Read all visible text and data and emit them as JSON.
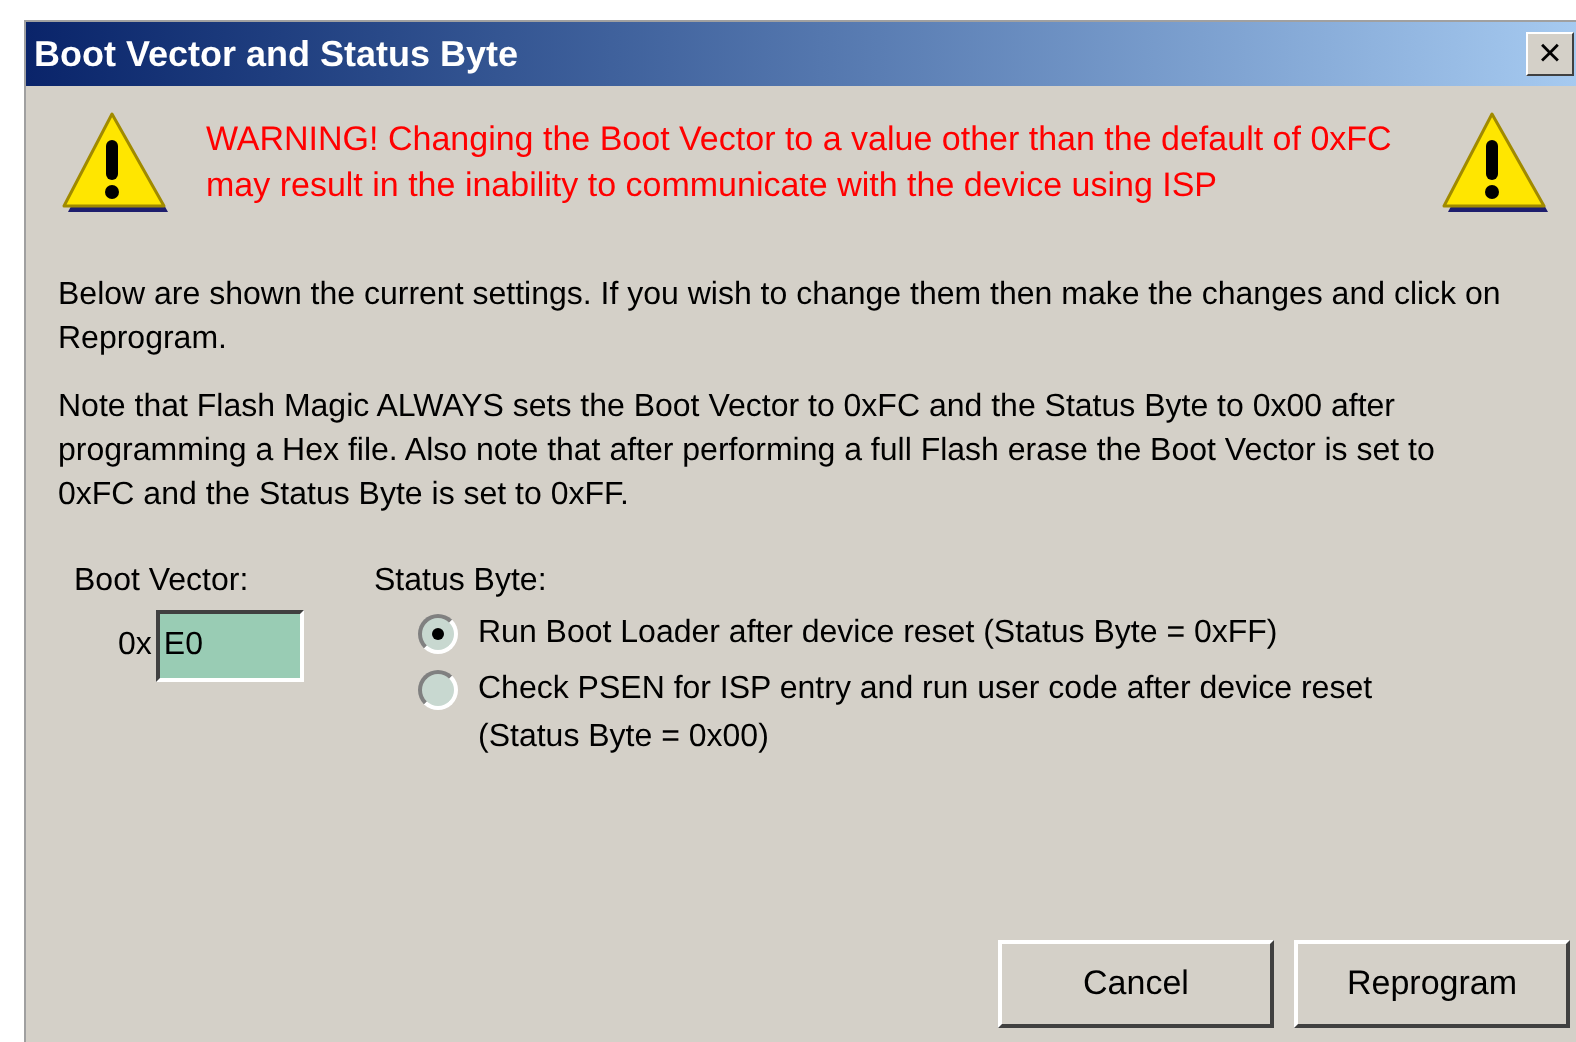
{
  "window": {
    "title": "Boot Vector and Status Byte",
    "close": "×"
  },
  "warning": "WARNING! Changing the Boot Vector to a value other than the default of 0xFC may result in the inability to communicate with the device using ISP",
  "paragraphs": [
    "Below are shown the current settings. If you wish to change them then make the changes and click on Reprogram.",
    "Note that Flash Magic ALWAYS sets the Boot Vector to 0xFC and the Status Byte to 0x00 after programming a Hex file. Also note that after performing a full Flash erase the Boot Vector is set to 0xFC and the Status Byte is set to 0xFF."
  ],
  "boot_vector": {
    "label": "Boot Vector:",
    "prefix": "0x",
    "value": "E0"
  },
  "status_byte": {
    "label": "Status Byte:",
    "options": [
      {
        "label": "Run Boot Loader after device reset (Status Byte = 0xFF)",
        "selected": true
      },
      {
        "label": "Check PSEN for ISP entry and run user code after device reset (Status Byte = 0x00)",
        "selected": false
      }
    ]
  },
  "buttons": [
    "Cancel",
    "Reprogram"
  ]
}
